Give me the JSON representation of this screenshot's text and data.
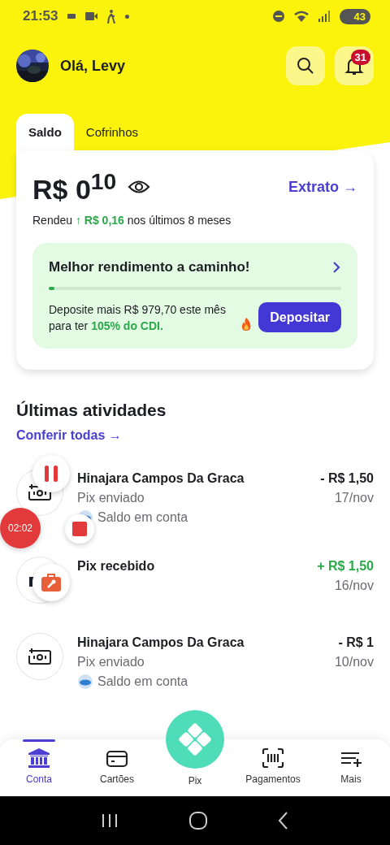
{
  "status_bar": {
    "time": "21:53",
    "battery": "43"
  },
  "header": {
    "greeting": "Olá, Levy",
    "notification_count": "31"
  },
  "tabs": [
    {
      "label": "Saldo",
      "selected": true
    },
    {
      "label": "Cofrinhos",
      "selected": false
    }
  ],
  "balance": {
    "amount": "R$ 0$^{10}$",
    "statement_link": "Extrato →",
    "yield_prefix": "Rendeu",
    "yield_amount": "↑ R$ 0,16",
    "yield_suffix": "nos últimos 8 meses"
  },
  "promo": {
    "title": "Melhor rendimento a caminho!",
    "level": 0.02,
    "text_prefix": "Deposite mais R$ 979,70 este mês para ter",
    "text_highlight": "105% do CDI.",
    "button": "Depositar"
  },
  "activities": {
    "title": "Últimas atividades",
    "link": "Conferir todas →",
    "items": [
      {
        "kind": "sent",
        "name": "Hinajara Campos Da Graca",
        "type": "Pix enviado",
        "source": "Saldo em conta",
        "incoming": false,
        "amount": "- R$ 1,50",
        "date": "17/nov"
      },
      {
        "kind": "received",
        "name": "Pix recebido",
        "incoming": true,
        "amount": "+ R$ 1,50",
        "date": "16/nov"
      },
      {
        "kind": "sent",
        "name": "Hinajara Campos Da Graca",
        "type": "Pix enviado",
        "source": "Saldo em conta",
        "incoming": false,
        "amount": "- R$ 1",
        "date": "10/nov"
      }
    ]
  },
  "nav": [
    {
      "label": "Conta",
      "kind": "account",
      "selected": true
    },
    {
      "label": "Cartões",
      "kind": "cards",
      "selected": false
    },
    {
      "label": "Pix",
      "kind": "pix",
      "selected": false
    },
    {
      "label": "Pagamentos",
      "kind": "payments",
      "selected": false
    },
    {
      "label": "Mais",
      "kind": "more",
      "selected": false
    }
  ],
  "recorder": {
    "timer": "02:02"
  }
}
